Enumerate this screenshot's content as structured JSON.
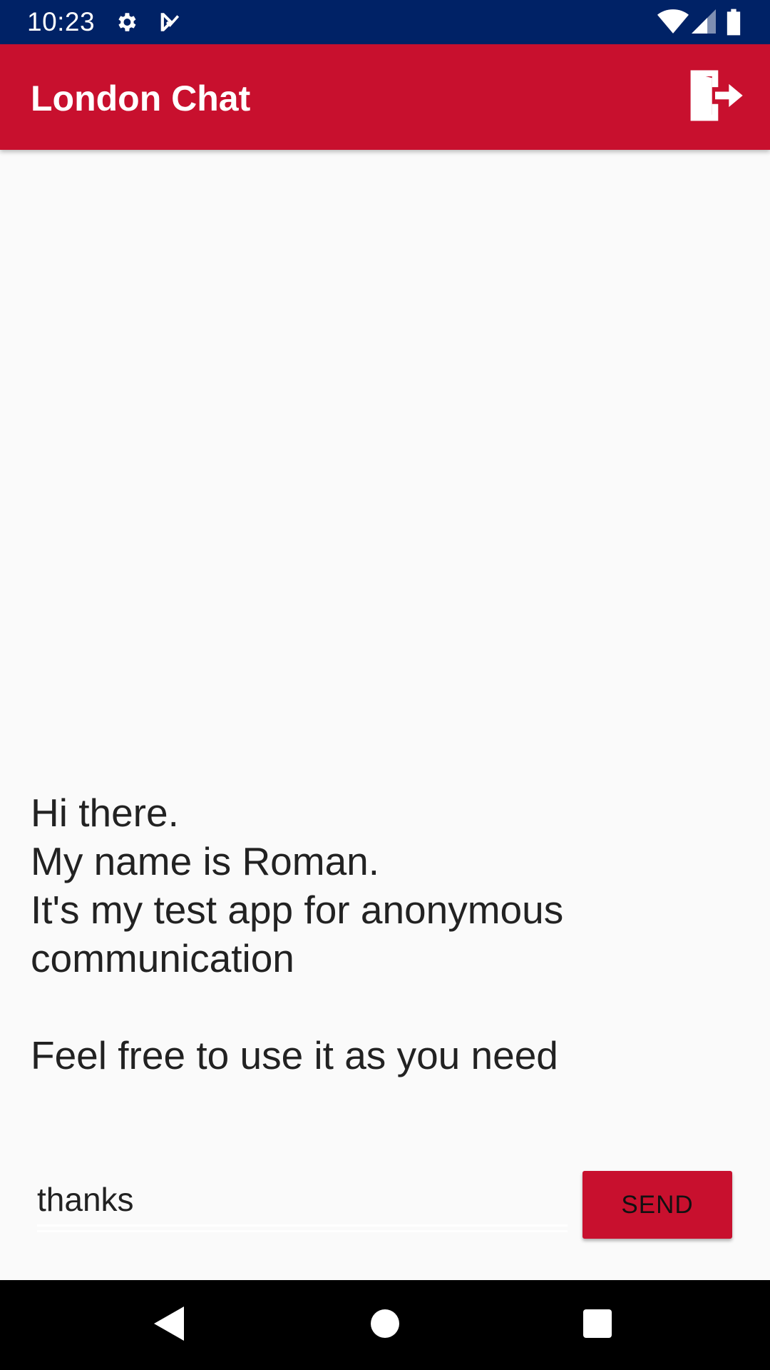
{
  "status_bar": {
    "time": "10:23",
    "icons": [
      "settings-icon",
      "task-check-icon",
      "wifi-icon",
      "signal-icon",
      "battery-icon"
    ]
  },
  "app_bar": {
    "title": "London Chat",
    "logout_icon": "exit-door-icon"
  },
  "chat": {
    "message": "Hi there.\nMy name is Roman.\nIt's my test app for anonymous communication\n\nFeel free to use it as you need"
  },
  "composer": {
    "input_value": "thanks",
    "send_label": "SEND"
  },
  "nav_bar": {
    "icons": [
      "back-icon",
      "home-icon",
      "recents-icon"
    ]
  },
  "colors": {
    "status_bar": "#002266",
    "app_bar": "#c8102e",
    "background": "#fafafa",
    "nav_bar": "#000000"
  }
}
